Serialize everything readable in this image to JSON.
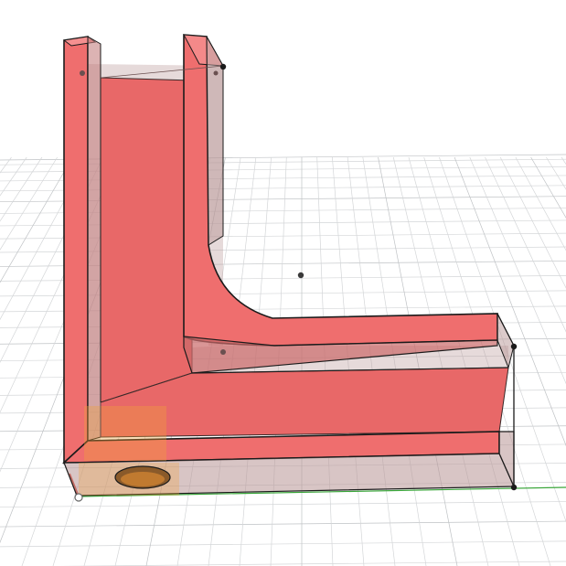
{
  "viewport": {
    "background": "#ffffff",
    "grid_color": "#d4d6d8",
    "grid_major_color": "#bfc2c5",
    "x_axis_color": "#3aa63a",
    "y_axis_color": "#d23a2a"
  },
  "model": {
    "face_color": "#f07474",
    "face_highlight": "#f59090",
    "face_shadow": "#cf5c5c",
    "transparent_color": "#b89696",
    "edge_color": "#1b1b1b",
    "hidden_edge_color": "#7a6060",
    "selection_color": "#f2a23a"
  },
  "icons": {
    "vertex": "vertex-point-icon",
    "origin": "origin-point-icon"
  }
}
